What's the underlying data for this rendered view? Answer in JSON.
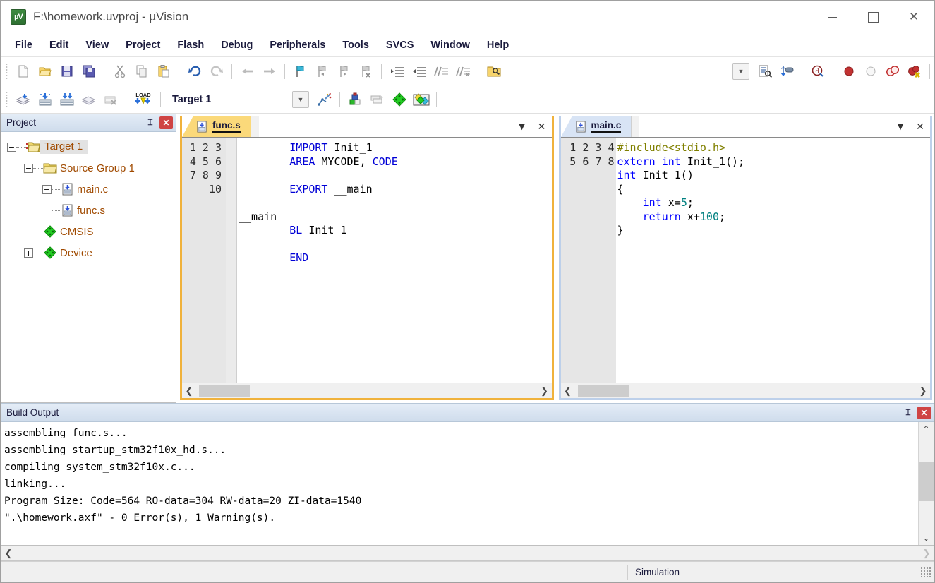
{
  "window": {
    "title": "F:\\homework.uvproj - µVision",
    "app_icon": "uvision-logo-icon",
    "controls": {
      "minimize": "–",
      "maximize": "□",
      "close": "✕"
    }
  },
  "menubar": {
    "items": [
      {
        "label": "File",
        "name": "menu-file"
      },
      {
        "label": "Edit",
        "name": "menu-edit"
      },
      {
        "label": "View",
        "name": "menu-view"
      },
      {
        "label": "Project",
        "name": "menu-project"
      },
      {
        "label": "Flash",
        "name": "menu-flash"
      },
      {
        "label": "Debug",
        "name": "menu-debug"
      },
      {
        "label": "Peripherals",
        "name": "menu-peripherals"
      },
      {
        "label": "Tools",
        "name": "menu-tools"
      },
      {
        "label": "SVCS",
        "name": "menu-svcs"
      },
      {
        "label": "Window",
        "name": "menu-window"
      },
      {
        "label": "Help",
        "name": "menu-help"
      }
    ]
  },
  "toolbar_main": {
    "icons": [
      "new-file-icon",
      "open-file-icon",
      "save-icon",
      "save-all-icon",
      "cut-icon",
      "copy-icon",
      "paste-icon",
      "undo-icon",
      "redo-icon",
      "navigate-back-icon",
      "navigate-forward-icon",
      "bookmark-toggle-icon",
      "bookmark-prev-icon",
      "bookmark-next-icon",
      "bookmark-clear-icon",
      "indent-icon",
      "outdent-icon",
      "comment-icon",
      "uncomment-icon",
      "find-in-files-icon",
      "debug-combo-arrow-icon",
      "config-wizard-icon",
      "debug-start-icon",
      "insert-bookmark-icon",
      "breakpoint-icon",
      "breakpoint-disable-icon",
      "breakpoint-toggle-icon",
      "breakpoint-kill-icon"
    ]
  },
  "toolbar_build": {
    "icons": [
      "translate-icon",
      "build-icon",
      "rebuild-icon",
      "batch-build-icon",
      "stop-build-icon",
      "download-icon"
    ],
    "target": {
      "label": "Target 1",
      "name": "target-selector",
      "dropdown_icon": "chevron-down-icon"
    },
    "right_icons": [
      "options-target-icon",
      "manage-project-items-icon",
      "multi-project-icon",
      "pack-installer-icon",
      "manage-run-env-icon"
    ]
  },
  "project_panel": {
    "title": "Project",
    "pin_icon": "pin-icon",
    "close_icon": "close-icon",
    "tree": [
      {
        "label": "Target 1",
        "icon": "target-folder-icon",
        "indent": 0,
        "expander": "−",
        "selected": true
      },
      {
        "label": "Source Group 1",
        "icon": "folder-icon",
        "indent": 1,
        "expander": "−",
        "selected": false
      },
      {
        "label": "main.c",
        "icon": "c-file-icon",
        "indent": 2,
        "expander": "+",
        "selected": false
      },
      {
        "label": "func.s",
        "icon": "asm-file-icon",
        "indent": 2,
        "expander": "",
        "selected": false
      },
      {
        "label": "CMSIS",
        "icon": "component-icon",
        "indent": 1,
        "expander": "",
        "selected": false
      },
      {
        "label": "Device",
        "icon": "component-icon",
        "indent": 1,
        "expander": "+",
        "selected": false
      }
    ]
  },
  "editors": [
    {
      "name": "editor-func-s",
      "tab_label": "func.s",
      "tab_icon": "asm-file-icon",
      "active": true,
      "dropdown_icon": "chevron-down-icon",
      "close_icon": "close-icon",
      "line_numbers": [
        "1",
        "2",
        "3",
        "4",
        "5",
        "6",
        "7",
        "8",
        "9",
        "10"
      ],
      "lines": [
        "        IMPORT Init_1",
        "        AREA MYCODE, CODE",
        "",
        "        EXPORT __main",
        "",
        "__main",
        "        BL Init_1",
        "",
        "        END",
        ""
      ]
    },
    {
      "name": "editor-main-c",
      "tab_label": "main.c",
      "tab_icon": "c-file-icon",
      "active": false,
      "dropdown_icon": "chevron-down-icon",
      "close_icon": "close-icon",
      "line_numbers": [
        "1",
        "2",
        "3",
        "4",
        "5",
        "6",
        "7",
        "8"
      ],
      "lines": [
        "#include<stdio.h>",
        "extern int Init_1();",
        "int Init_1()",
        "{",
        "    int x=5;",
        "    return x+100;",
        "}",
        ""
      ]
    }
  ],
  "build_output": {
    "title": "Build Output",
    "pin_icon": "pin-icon",
    "close_icon": "close-icon",
    "lines": [
      "assembling func.s...",
      "assembling startup_stm32f10x_hd.s...",
      "compiling system_stm32f10x.c...",
      "linking...",
      "Program Size: Code=564 RO-data=304 RW-data=20 ZI-data=1540",
      "\".\\homework.axf\" - 0 Error(s), 1 Warning(s)."
    ],
    "scroll_up_icon": "chevron-up-icon",
    "scroll_down_icon": "chevron-down-icon",
    "scroll_left_icon": "chevron-left-icon",
    "scroll_right_icon": "chevron-right-icon"
  },
  "statusbar": {
    "left": "",
    "mode": "Simulation",
    "right": "",
    "grip_icon": "resize-grip-icon"
  },
  "colors": {
    "accent_active_border": "#f0b23c",
    "accent_inactive_border": "#bdd0ea",
    "keyword": "#0000d6",
    "string": "#808000",
    "number": "#008080",
    "tree_text": "#a04a00",
    "panel_header": "#cfdcec"
  }
}
